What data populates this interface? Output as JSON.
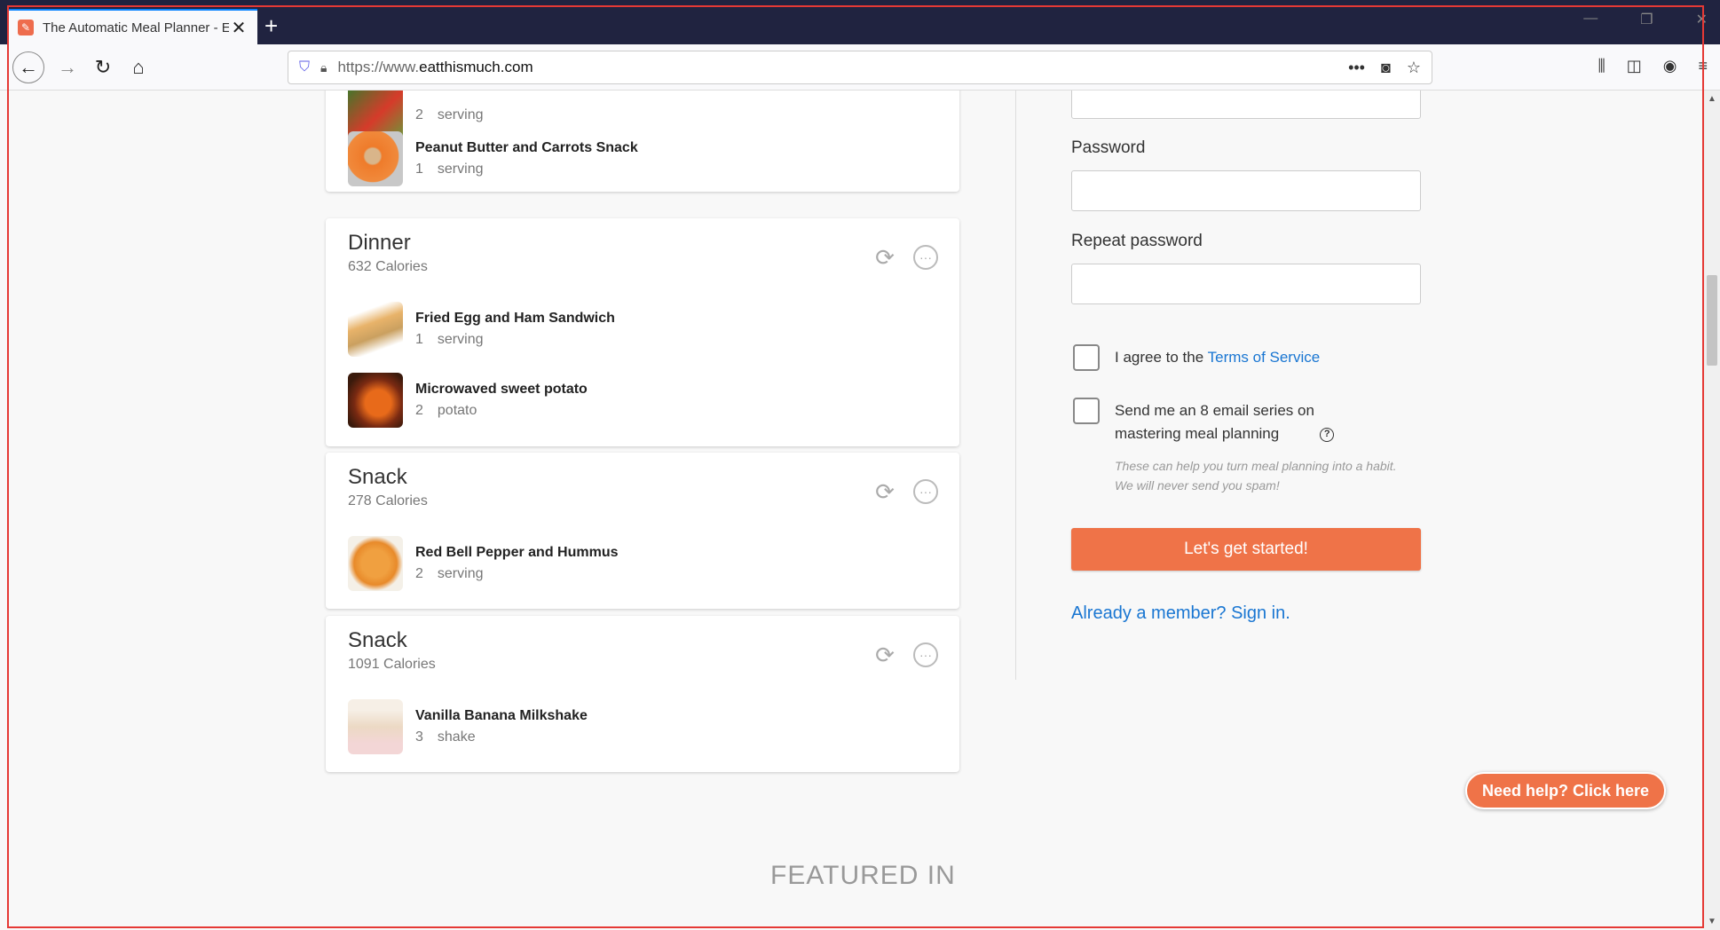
{
  "browser": {
    "tab_title": "The Automatic Meal Planner - E",
    "url_prefix": "https://www.",
    "url_domain": "eatthismuch.com"
  },
  "meals": [
    {
      "title": "",
      "calories": "",
      "foods": [
        {
          "name": "",
          "qty": "2",
          "unit": "serving",
          "icon": "salad-thumb"
        },
        {
          "name": "Peanut Butter and Carrots Snack",
          "qty": "1",
          "unit": "serving",
          "icon": "carrots-thumb"
        }
      ]
    },
    {
      "title": "Dinner",
      "calories": "632 Calories",
      "foods": [
        {
          "name": "Fried Egg and Ham Sandwich",
          "qty": "1",
          "unit": "serving",
          "icon": "sandwich-thumb"
        },
        {
          "name": "Microwaved sweet potato",
          "qty": "2",
          "unit": "potato",
          "icon": "sweet-potato-thumb"
        }
      ]
    },
    {
      "title": "Snack",
      "calories": "278 Calories",
      "foods": [
        {
          "name": "Red Bell Pepper and Hummus",
          "qty": "2",
          "unit": "serving",
          "icon": "hummus-thumb"
        }
      ]
    },
    {
      "title": "Snack",
      "calories": "1091 Calories",
      "foods": [
        {
          "name": "Vanilla Banana Milkshake",
          "qty": "3",
          "unit": "shake",
          "icon": "milkshake-thumb"
        }
      ]
    }
  ],
  "form": {
    "password_label": "Password",
    "repeat_password_label": "Repeat password",
    "agree_prefix": "I agree to the ",
    "agree_link": "Terms of Service",
    "email_series_line1": "Send me an 8 email series on",
    "email_series_line2": "mastering meal planning",
    "help_glyph": "?",
    "note": "These can help you turn meal planning into a habit. We will never send you spam!",
    "cta_label": "Let's get started!",
    "signin_link": "Already a member? Sign in."
  },
  "featured_heading": "FEATURED IN",
  "help_button": "Need help? Click here",
  "colors": {
    "accent": "#ef7348",
    "link": "#1976d2",
    "tabbar": "#202340"
  }
}
